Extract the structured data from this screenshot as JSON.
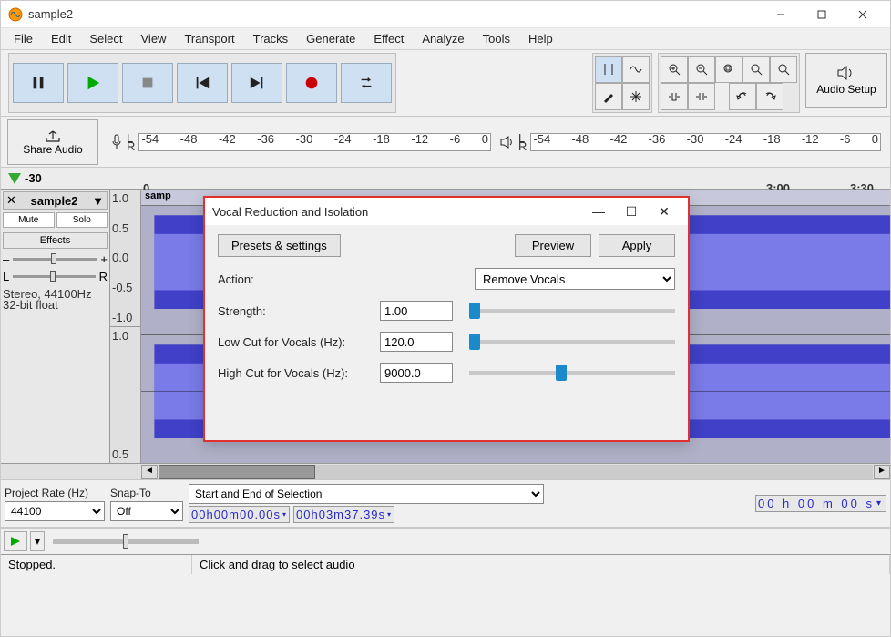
{
  "window": {
    "title": "sample2"
  },
  "menu": [
    "File",
    "Edit",
    "Select",
    "View",
    "Transport",
    "Tracks",
    "Generate",
    "Effect",
    "Analyze",
    "Tools",
    "Help"
  ],
  "toolbar": {
    "audio_setup": "Audio Setup",
    "share": "Share Audio"
  },
  "meter_ticks": [
    "-54",
    "-48",
    "-42",
    "-36",
    "-30",
    "-24",
    "-18",
    "-12",
    "-6",
    "0"
  ],
  "ruler": {
    "pre": "-30",
    "marks": [
      "0",
      "3:00",
      "3:30"
    ]
  },
  "track": {
    "name": "sample2",
    "clip_label": "samp",
    "buttons": {
      "mute": "Mute",
      "solo": "Solo"
    },
    "effects": "Effects",
    "gain": {
      "minus": "–",
      "plus": "+"
    },
    "pan": {
      "l": "L",
      "r": "R"
    },
    "info_line1": "Stereo, 44100Hz",
    "info_line2": "32-bit float",
    "scale": [
      "1.0",
      "0.5",
      "0.0",
      "-0.5",
      "-1.0"
    ]
  },
  "selection": {
    "project_rate_label": "Project Rate (Hz)",
    "project_rate": "44100",
    "snap_label": "Snap-To",
    "snap": "Off",
    "mode": "Start and End of Selection",
    "start": "00h00m00.00s",
    "end": "00h03m37.39s",
    "big_time": "00 h 00 m 00 s"
  },
  "status": {
    "left": "Stopped.",
    "hint": "Click and drag to select audio"
  },
  "dialog": {
    "title": "Vocal Reduction and Isolation",
    "presets_btn": "Presets & settings",
    "preview_btn": "Preview",
    "apply_btn": "Apply",
    "action_label": "Action:",
    "action_value": "Remove Vocals",
    "strength_label": "Strength:",
    "strength_value": "1.00",
    "lowcut_label": "Low Cut for Vocals (Hz):",
    "lowcut_value": "120.0",
    "highcut_label": "High Cut for Vocals (Hz):",
    "highcut_value": "9000.0"
  }
}
